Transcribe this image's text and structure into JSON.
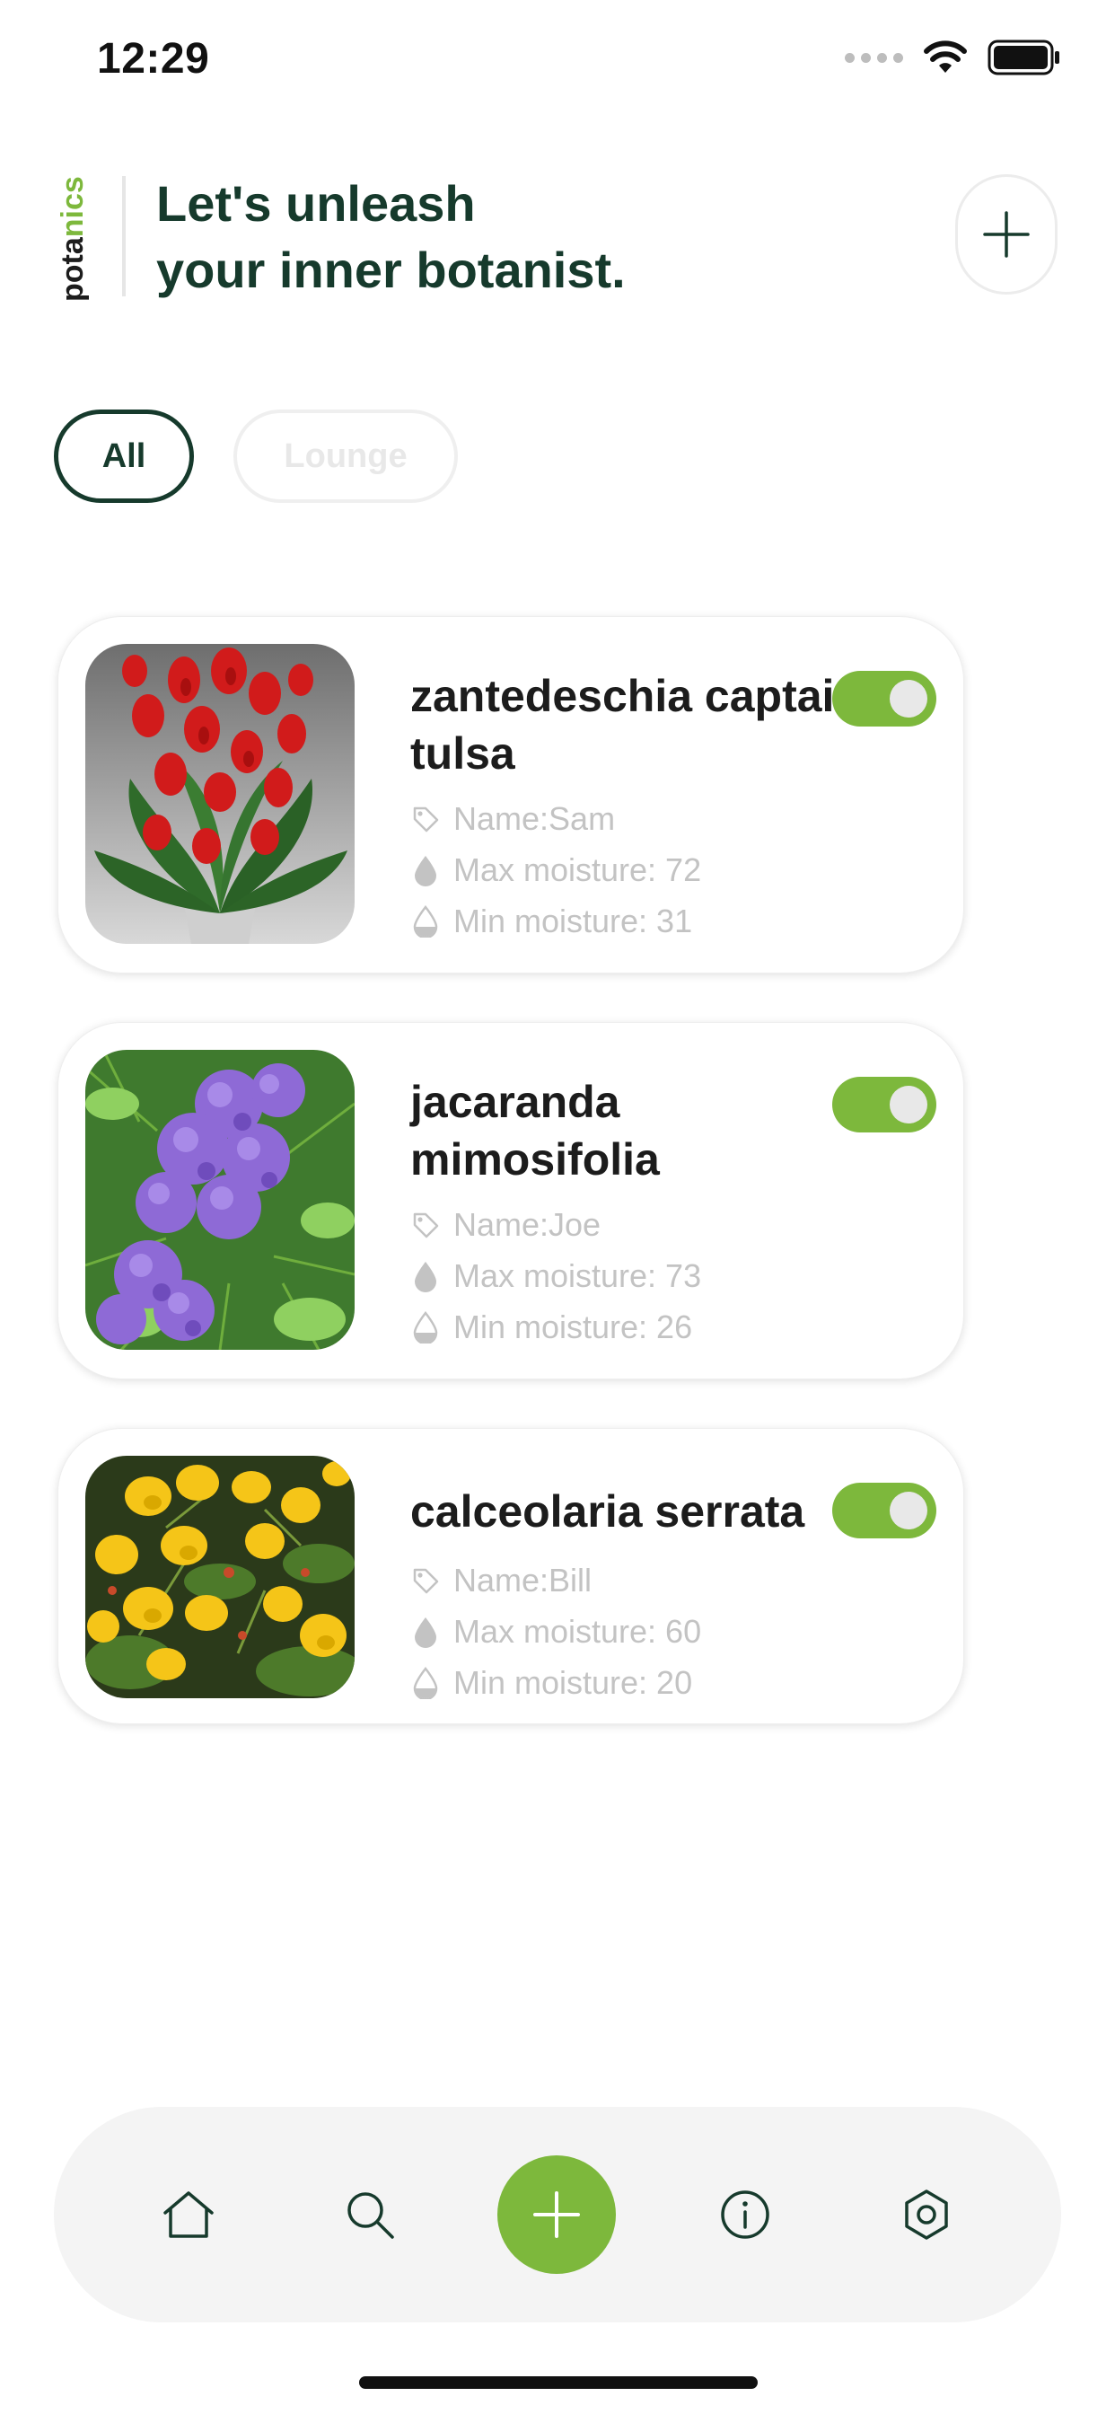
{
  "status_bar": {
    "time": "12:29"
  },
  "brand": {
    "logo_text": "potanics",
    "headline_line1": "Let's unleash",
    "headline_line2": "your inner botanist."
  },
  "filters": [
    {
      "label": "All",
      "active": true
    },
    {
      "label": "Lounge",
      "active": false
    }
  ],
  "plants": [
    {
      "title": "zantedeschia captain tulsa",
      "name": "Name:Sam",
      "max_moisture": "Max moisture: 72",
      "min_moisture": "Min moisture: 31",
      "enabled": true
    },
    {
      "title": "jacaranda mimosifolia",
      "name": "Name:Joe",
      "max_moisture": "Max moisture: 73",
      "min_moisture": "Min moisture: 26",
      "enabled": true
    },
    {
      "title": "calceolaria serrata",
      "name": "Name:Bill",
      "max_moisture": "Max moisture: 60",
      "min_moisture": "Min moisture: 20",
      "enabled": true
    }
  ],
  "icons": [
    "plus-icon",
    "tag-icon",
    "drop-filled-icon",
    "drop-half-icon",
    "home-icon",
    "search-icon",
    "info-icon",
    "settings-hexagon-icon",
    "wifi-icon",
    "battery-icon"
  ],
  "colors": {
    "accent": "#7db83c",
    "dark_green": "#163a2c",
    "muted_text": "#c3c3c3",
    "nav_bg": "#f4f4f4"
  }
}
